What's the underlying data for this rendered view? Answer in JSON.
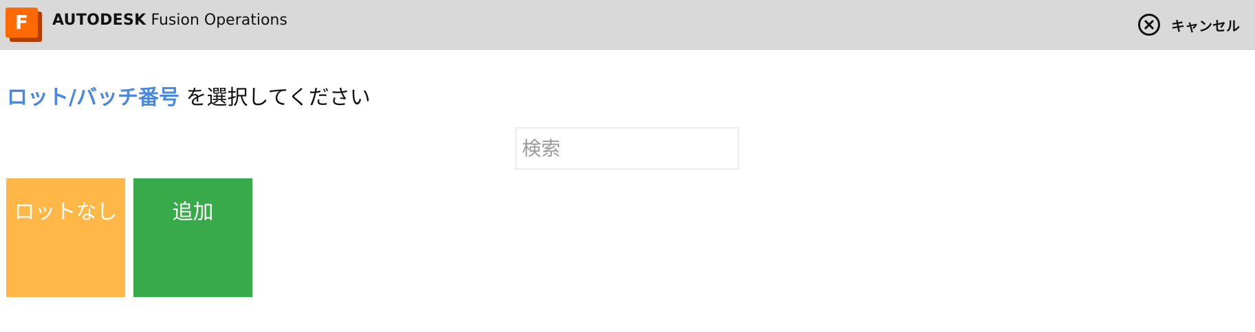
{
  "header": {
    "logo_letter": "F",
    "brand_strong": "AUTODESK",
    "brand_rest": " Fusion Operations",
    "cancel_label": "キャンセル",
    "cancel_icon": "close-circle-icon"
  },
  "prompt": {
    "highlight": "ロット/バッチ番号",
    "rest": " を選択してください"
  },
  "search": {
    "placeholder": "検索",
    "value": ""
  },
  "tiles": [
    {
      "label": "ロットなし"
    },
    {
      "label": "追加"
    }
  ],
  "colors": {
    "header_bg": "#d9d9d9",
    "logo_orange": "#ff6b00",
    "highlight_blue": "#4a88e0",
    "no_lot_tile": "#ffb848",
    "add_tile": "#39aa49"
  }
}
